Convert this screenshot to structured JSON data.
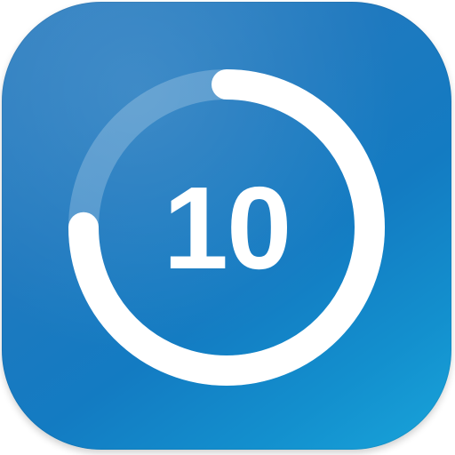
{
  "app_icon": {
    "name": "countdown-timer-app-icon",
    "count": "10",
    "progress_fraction": 0.75,
    "colors": {
      "background_top_left": "#2f7fc1",
      "background_bottom_right": "#19a4da",
      "ring_active": "#ffffff",
      "ring_track": "#ffffff",
      "text": "#ffffff"
    }
  }
}
